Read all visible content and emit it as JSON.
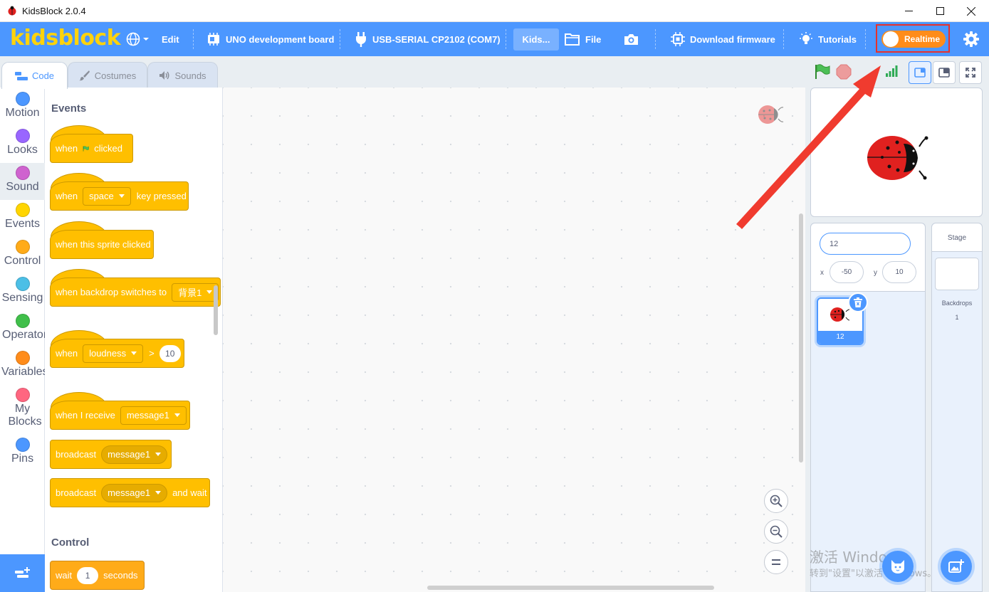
{
  "window": {
    "title": "KidsBlock 2.0.4"
  },
  "menubar": {
    "logo": "kidsblock",
    "edit": "Edit",
    "board": "UNO development board",
    "port": "USB-SERIAL CP2102 (COM7)",
    "project": "Kids...",
    "file": "File",
    "download": "Download firmware",
    "tutorials": "Tutorials",
    "realtime": "Realtime",
    "accent": "#4c97ff",
    "logo_color": "#ffd30b"
  },
  "tabs": [
    {
      "label": "Code",
      "active": true
    },
    {
      "label": "Costumes",
      "active": false
    },
    {
      "label": "Sounds",
      "active": false
    }
  ],
  "categories": [
    {
      "label": "Motion",
      "color": "#4c97ff"
    },
    {
      "label": "Looks",
      "color": "#9966ff"
    },
    {
      "label": "Sound",
      "color": "#cf63cf",
      "selected": true
    },
    {
      "label": "Events",
      "color": "#ffd500"
    },
    {
      "label": "Control",
      "color": "#ffab19"
    },
    {
      "label": "Sensing",
      "color": "#4cbfe6"
    },
    {
      "label": "Operators",
      "color": "#40bf4a"
    },
    {
      "label": "Variables",
      "color": "#ff8c1a"
    },
    {
      "label": "My Blocks",
      "color": "#ff6680"
    },
    {
      "label": "Pins",
      "color": "#4c97ff"
    }
  ],
  "palette": {
    "events_title": "Events",
    "control_title": "Control",
    "when": "when",
    "clicked": "clicked",
    "space": "space",
    "key_pressed": "key pressed",
    "sprite_clicked": "when this sprite clicked",
    "backdrop_switches": "when backdrop switches to",
    "backdrop_value": "背景1",
    "loudness": "loudness",
    "gt": ">",
    "loudness_value": "10",
    "receive": "when I receive",
    "message": "message1",
    "broadcast": "broadcast",
    "and_wait": "and wait",
    "wait": "wait",
    "wait_value": "1",
    "seconds": "seconds"
  },
  "sprite": {
    "name": "12",
    "x_label": "x",
    "x": "-50",
    "y_label": "y",
    "y": "10",
    "card_name": "12"
  },
  "stage_pane": {
    "title": "Stage",
    "backdrops_label": "Backdrops",
    "backdrops_count": "1"
  },
  "watermark": {
    "line1": "激活 Windows",
    "line2": "转到\"设置\"以激活 Windows。"
  }
}
